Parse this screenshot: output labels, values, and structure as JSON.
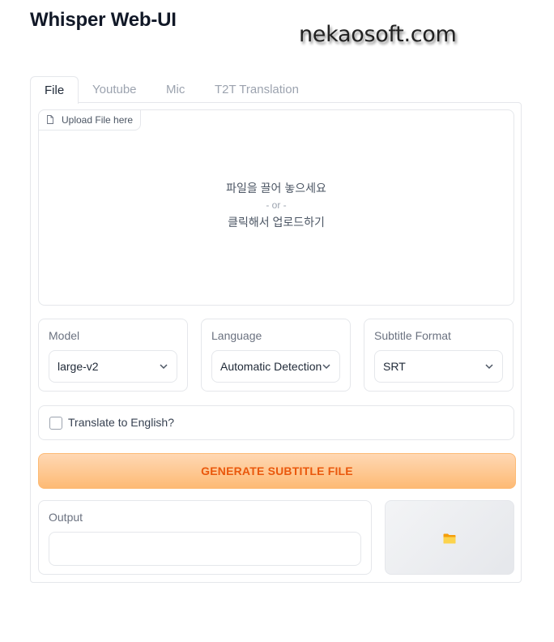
{
  "app": {
    "title": "Whisper Web-UI",
    "watermark": "nekaosoft.com"
  },
  "tabs": [
    {
      "label": "File",
      "active": true
    },
    {
      "label": "Youtube"
    },
    {
      "label": "Mic"
    },
    {
      "label": "T2T Translation"
    }
  ],
  "upload": {
    "tag_label": "Upload File here",
    "tag_icon": "file-icon",
    "drop_text": "파일을 끌어 놓으세요",
    "or_text": "- or -",
    "click_text": "클릭해서 업로드하기"
  },
  "model": {
    "label": "Model",
    "value": "large-v2"
  },
  "language": {
    "label": "Language",
    "value": "Automatic Detection"
  },
  "subtitle_format": {
    "label": "Subtitle Format",
    "value": "SRT"
  },
  "translate": {
    "label": "Translate to English?",
    "checked": false
  },
  "generate_button": {
    "label": "GENERATE SUBTITLE FILE",
    "accent": "#ea580c"
  },
  "output": {
    "label": "Output",
    "value": ""
  },
  "folder_button": {
    "icon": "folder-icon",
    "color": "#fbbf24"
  }
}
